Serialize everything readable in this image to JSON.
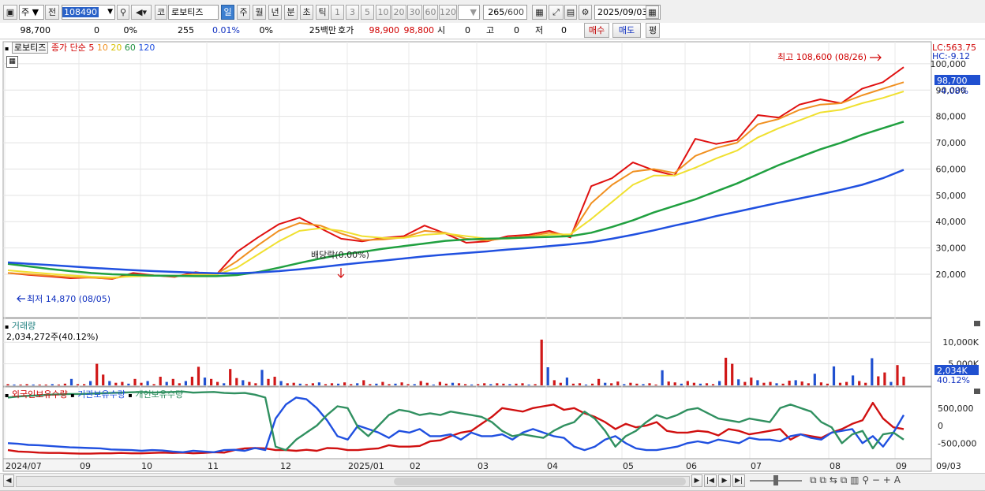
{
  "toolbar": {
    "market_sel": "주",
    "prev_label": "전",
    "code": "108490",
    "type_badge": "코",
    "stock_name": "로보티즈",
    "periods": [
      "일",
      "주",
      "월",
      "년",
      "분",
      "초",
      "틱"
    ],
    "active_period": "일",
    "nums": [
      "1",
      "3",
      "5",
      "10",
      "20",
      "30",
      "60",
      "120"
    ],
    "count": "265",
    "count_max": "/600",
    "date": "2025/09/03"
  },
  "quote": {
    "price": "98,700",
    "change": "0",
    "change_rate": "0%",
    "volume": "255",
    "vol_rate": "0.01%",
    "vol_rate2": "0%",
    "amount": "25백만",
    "hoga_label": "호가",
    "ask": "98,900",
    "bid": "98,800",
    "time_label": "시",
    "open": "0",
    "high_label": "고",
    "high": "0",
    "low_label": "저",
    "low": "0",
    "buy": "매수",
    "sell": "매도",
    "eval": "평"
  },
  "price_pane": {
    "name": "로보티즈",
    "ma_label": "종가 단순",
    "ma_periods": [
      "5",
      "10",
      "20",
      "60",
      "120"
    ],
    "ma_colors": [
      "#e01010",
      "#f09020",
      "#f0e030",
      "#20a040",
      "#2050e0"
    ],
    "lc": "LC:563.75",
    "hc": "HC:-9.12",
    "current_price": "98,700",
    "current_change": "-4.08%",
    "max_label": "최고 108,600 (08/26)",
    "min_label": "최저 14,870 (08/05)",
    "dividend_label": "배당락(0.00%)",
    "y_ticks": [
      "100,000",
      "90,000",
      "80,000",
      "70,000",
      "60,000",
      "50,000",
      "40,000",
      "30,000",
      "20,000"
    ]
  },
  "volume_pane": {
    "title": "거래량",
    "value": "2,034,272주(40.12%)",
    "y_ticks": [
      "10,000K",
      "5,000K"
    ],
    "current": "2,034K",
    "current_pct": "40.12%"
  },
  "holding_pane": {
    "series": [
      "외국인보유수량",
      "기관보유수량",
      "개인보유수량"
    ],
    "colors": [
      "#d01010",
      "#2050e0",
      "#309060"
    ],
    "y_ticks": [
      "500,000",
      "0",
      "-500,000"
    ]
  },
  "x_axis": {
    "labels": [
      "2024/07",
      "09",
      "10",
      "11",
      "12",
      "2025/01",
      "02",
      "03",
      "04",
      "05",
      "06",
      "07",
      "08",
      "09"
    ],
    "right_label": "09/03"
  },
  "chart_data": {
    "type": "line",
    "series": [
      {
        "name": "5",
        "values": [
          20500,
          19800,
          19200,
          18500,
          18800,
          18200,
          20500,
          19600,
          19000,
          20800,
          19800,
          28500,
          34000,
          39000,
          41500,
          37500,
          33500,
          32500,
          33800,
          34500,
          38500,
          35500,
          32000,
          32500,
          34500,
          35000,
          36500,
          34000,
          53500,
          56500,
          62500,
          59500,
          57500,
          71500,
          69500,
          71000,
          80500,
          79500,
          84500,
          86500,
          85000,
          90500,
          93000,
          98700
        ]
      },
      {
        "name": "10",
        "values": [
          20500,
          20000,
          19500,
          18900,
          18700,
          18400,
          19600,
          19600,
          19200,
          20100,
          20000,
          25000,
          31000,
          36500,
          39500,
          38500,
          35500,
          33000,
          33200,
          34000,
          36500,
          35800,
          33500,
          32800,
          33800,
          34500,
          35800,
          34800,
          47000,
          54000,
          59000,
          60000,
          58500,
          65000,
          68000,
          70000,
          77000,
          79000,
          82500,
          84500,
          85000,
          88000,
          90500,
          93000
        ]
      },
      {
        "name": "20",
        "values": [
          21500,
          20800,
          20200,
          19600,
          19100,
          18800,
          19200,
          19400,
          19400,
          19700,
          19800,
          22500,
          27500,
          32500,
          36500,
          37500,
          36500,
          34500,
          33800,
          33800,
          35000,
          35500,
          34500,
          33500,
          33500,
          34000,
          35000,
          35200,
          41000,
          47500,
          54000,
          57500,
          57500,
          60500,
          64000,
          67000,
          72000,
          75500,
          78500,
          81500,
          82500,
          85000,
          87000,
          89500
        ]
      },
      {
        "name": "60",
        "values": [
          24000,
          23000,
          22000,
          21200,
          20500,
          20000,
          19800,
          19500,
          19400,
          19300,
          19300,
          19700,
          20800,
          22500,
          24300,
          26000,
          27500,
          28500,
          29700,
          30700,
          31700,
          32700,
          33200,
          33500,
          33700,
          34000,
          34200,
          34500,
          35800,
          38000,
          40500,
          43500,
          46000,
          48500,
          51500,
          54500,
          58000,
          61500,
          64500,
          67500,
          70000,
          73000,
          75500,
          78000
        ]
      },
      {
        "name": "120",
        "values": [
          24500,
          24000,
          23500,
          23000,
          22500,
          22000,
          21600,
          21200,
          20900,
          20600,
          20400,
          20400,
          20700,
          21200,
          21900,
          22700,
          23600,
          24400,
          25200,
          26000,
          26800,
          27500,
          28100,
          28700,
          29400,
          30000,
          30700,
          31400,
          32200,
          33500,
          35000,
          36700,
          38500,
          40200,
          42100,
          43800,
          45500,
          47200,
          48800,
          50400,
          52100,
          54000,
          56500,
          59700
        ]
      }
    ],
    "ylim": [
      10000,
      115000
    ],
    "log_scale": false,
    "grid": true,
    "volume_bars_k": [
      300,
      200,
      200,
      300,
      200,
      200,
      200,
      300,
      200,
      400,
      1500,
      300,
      300,
      1000,
      5000,
      2500,
      1000,
      600,
      800,
      400,
      1500,
      600,
      1000,
      300,
      2000,
      800,
      1500,
      500,
      1000,
      2000,
      4300,
      1800,
      1500,
      800,
      500,
      3800,
      1700,
      1200,
      800,
      500,
      3600,
      1500,
      2000,
      1000,
      500,
      600,
      400,
      300,
      500,
      700,
      300,
      500,
      400,
      700,
      300,
      500,
      1200,
      300,
      400,
      800,
      300,
      400,
      700,
      300,
      300,
      1000,
      600,
      200,
      800,
      400,
      600,
      500,
      300,
      200,
      300,
      500,
      300,
      500,
      400,
      300,
      400,
      500,
      200,
      300,
      10600,
      4200,
      1200,
      600,
      1800,
      400,
      500,
      200,
      400,
      1500,
      600,
      500,
      900,
      300,
      600,
      400,
      300,
      500,
      200,
      3500,
      900,
      700,
      400,
      1000,
      600,
      400,
      500,
      300,
      1000,
      6400,
      5000,
      1400,
      800,
      1800,
      1200,
      600,
      800,
      500,
      400,
      1100,
      1200,
      900,
      500,
      2700,
      700,
      400,
      4400,
      600,
      800,
      2300,
      1000,
      600,
      6300,
      2100,
      3000,
      800,
      4700,
      2034
    ],
    "foreign_holding": [
      -700000,
      -740000,
      -750000,
      -770000,
      -780000,
      -780000,
      -790000,
      -800000,
      -800000,
      -790000,
      -790000,
      -780000,
      -790000,
      -790000,
      -780000,
      -770000,
      -780000,
      -770000,
      -790000,
      -780000,
      -760000,
      -770000,
      -700000,
      -650000,
      -640000,
      -650000,
      -700000,
      -700000,
      -720000,
      -690000,
      -720000,
      -640000,
      -650000,
      -700000,
      -700000,
      -670000,
      -650000,
      -560000,
      -600000,
      -600000,
      -580000,
      -450000,
      -420000,
      -300000,
      -200000,
      -150000,
      50000,
      250000,
      500000,
      450000,
      400000,
      500000,
      550000,
      600000,
      450000,
      500000,
      350000,
      250000,
      100000,
      -100000,
      50000,
      -50000,
      0,
      100000,
      -150000,
      -200000,
      -200000,
      -150000,
      -180000,
      -280000,
      -100000,
      -150000,
      -250000,
      -200000,
      -150000,
      -100000,
      -400000,
      -250000,
      -300000,
      -350000,
      -200000,
      -100000,
      50000,
      150000,
      650000,
      200000,
      -50000,
      -100000
    ],
    "inst_holding": [
      -500000,
      -520000,
      -550000,
      -560000,
      -580000,
      -600000,
      -620000,
      -630000,
      -640000,
      -650000,
      -680000,
      -690000,
      -700000,
      -720000,
      -700000,
      -710000,
      -740000,
      -760000,
      -720000,
      -740000,
      -760000,
      -700000,
      -690000,
      -720000,
      -640000,
      -700000,
      200000,
      600000,
      800000,
      750000,
      500000,
      150000,
      -300000,
      -400000,
      0,
      -100000,
      -200000,
      -350000,
      -150000,
      -200000,
      -100000,
      -300000,
      -300000,
      -250000,
      -400000,
      -200000,
      -300000,
      -300000,
      -250000,
      -400000,
      -200000,
      -100000,
      -200000,
      -300000,
      -350000,
      -600000,
      -700000,
      -600000,
      -400000,
      -300000,
      -500000,
      -650000,
      -700000,
      -700000,
      -650000,
      -600000,
      -500000,
      -450000,
      -500000,
      -400000,
      -450000,
      -500000,
      -350000,
      -400000,
      -400000,
      -450000,
      -300000,
      -250000,
      -350000,
      -400000,
      -200000,
      -150000,
      -100000,
      -500000,
      -300000,
      -600000,
      -200000,
      300000
    ],
    "indiv_holding": [
      800000,
      830000,
      850000,
      860000,
      880000,
      890000,
      900000,
      900000,
      910000,
      920000,
      930000,
      940000,
      950000,
      960000,
      940000,
      950000,
      960000,
      970000,
      940000,
      950000,
      960000,
      930000,
      920000,
      930000,
      880000,
      800000,
      -600000,
      -700000,
      -400000,
      -200000,
      0,
      300000,
      550000,
      500000,
      -50000,
      -300000,
      0,
      300000,
      450000,
      400000,
      300000,
      350000,
      300000,
      400000,
      350000,
      300000,
      250000,
      100000,
      -150000,
      -300000,
      -250000,
      -300000,
      -350000,
      -150000,
      0,
      100000,
      400000,
      200000,
      -150000,
      -600000,
      -300000,
      -150000,
      100000,
      300000,
      200000,
      300000,
      450000,
      500000,
      350000,
      200000,
      150000,
      100000,
      200000,
      150000,
      100000,
      500000,
      600000,
      500000,
      400000,
      100000,
      -50000,
      -500000,
      -250000,
      -150000,
      -650000,
      -250000,
      -200000,
      -400000
    ]
  }
}
